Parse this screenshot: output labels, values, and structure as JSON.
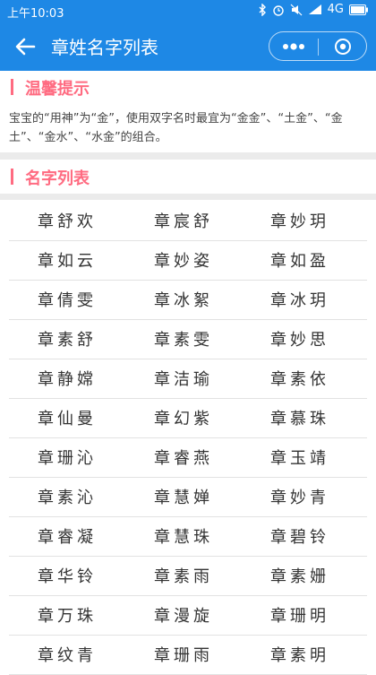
{
  "status_bar": {
    "time": "上午10:03",
    "network": "4G"
  },
  "nav": {
    "title": "章姓名字列表"
  },
  "tip_section": {
    "title": "温馨提示",
    "text": "宝宝的“用神”为“金”，使用双字名时最宜为“金金”、“土金”、“金土”、“金水”、“水金”的组合。"
  },
  "names_section": {
    "title": "名字列表",
    "rows": [
      [
        "章舒欢",
        "章宸舒",
        "章妙玥"
      ],
      [
        "章如云",
        "章妙姿",
        "章如盈"
      ],
      [
        "章倩雯",
        "章冰絮",
        "章冰玥"
      ],
      [
        "章素舒",
        "章素雯",
        "章妙思"
      ],
      [
        "章静嫦",
        "章洁瑜",
        "章素依"
      ],
      [
        "章仙曼",
        "章幻紫",
        "章慕珠"
      ],
      [
        "章珊沁",
        "章睿燕",
        "章玉靖"
      ],
      [
        "章素沁",
        "章慧婵",
        "章妙青"
      ],
      [
        "章睿凝",
        "章慧珠",
        "章碧铃"
      ],
      [
        "章华铃",
        "章素雨",
        "章素姗"
      ],
      [
        "章万珠",
        "章漫旋",
        "章珊明"
      ],
      [
        "章纹青",
        "章珊雨",
        "章素明"
      ]
    ]
  },
  "colors": {
    "primary": "#1e88e5",
    "accent": "#ff6b81"
  },
  "icons": [
    "back-arrow-icon",
    "more-dots-icon",
    "close-circle-icon",
    "bluetooth-icon",
    "alarm-icon",
    "mute-icon",
    "signal-icon",
    "battery-icon"
  ]
}
